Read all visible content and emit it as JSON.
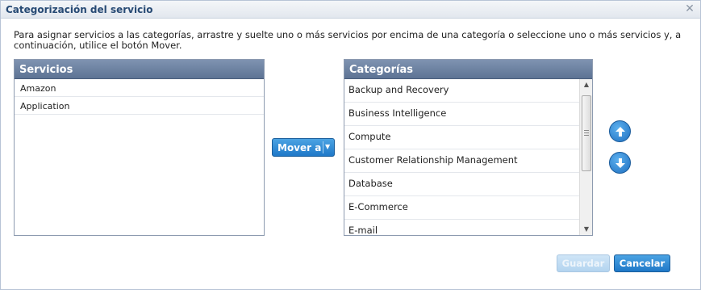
{
  "dialog": {
    "title": "Categorización del servicio",
    "instructions": "Para asignar servicios a las categorías, arrastre y suelte uno o más servicios por encima de una categoría o seleccione uno o más servicios y, a continuación, utilice el botón Mover."
  },
  "services": {
    "header": "Servicios",
    "items": [
      "Amazon",
      "Application"
    ]
  },
  "categories": {
    "header": "Categorías",
    "items": [
      "Backup and Recovery",
      "Business Intelligence",
      "Compute",
      "Customer Relationship Management",
      "Database",
      "E-Commerce",
      "E-mail"
    ]
  },
  "actions": {
    "move_label": "Mover a",
    "save_label": "Guardar",
    "cancel_label": "Cancelar"
  },
  "icons": {
    "close": "close-icon",
    "move_dropdown": "chevron-down-icon",
    "move_up": "arrow-up-icon",
    "move_down": "arrow-down-icon"
  },
  "colors": {
    "accent": "#1f78c8",
    "panel_header": "#6a7fa0",
    "title_text": "#274a74"
  }
}
